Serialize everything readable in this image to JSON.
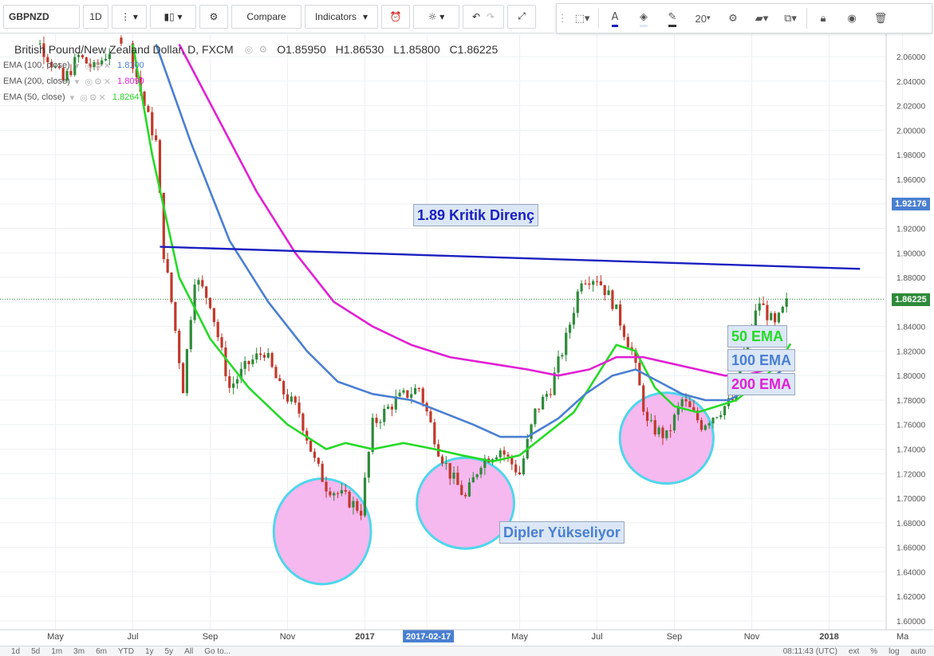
{
  "toolbar": {
    "symbol": "GBPNZD",
    "interval": "1D",
    "compare_label": "Compare",
    "indicators_label": "Indicators",
    "font_size": "20"
  },
  "legend": {
    "title": "British Pound/New Zealand Dollar, D, FXCM",
    "open": "O1.85950",
    "high": "H1.86530",
    "low": "L1.85800",
    "close": "C1.86225",
    "ema_rows": [
      {
        "label": "EMA (100, close)",
        "value": "1.8100",
        "color": "#4a7fd1"
      },
      {
        "label": "EMA (200, close)",
        "value": "1.8090",
        "color": "#e020d4"
      },
      {
        "label": "EMA (50, close)",
        "value": "1.8264",
        "color": "#26d926"
      }
    ]
  },
  "annotations": {
    "resistance": "1.89 Kritik Direnç",
    "ema50": "50 EMA",
    "ema100": "100 EMA",
    "ema200": "200 EMA",
    "lows": "Dipler Yükseliyor"
  },
  "price_tags": {
    "current": "1.86225",
    "upper": "1.92176"
  },
  "bottom": {
    "ranges": [
      "1d",
      "5d",
      "1m",
      "3m",
      "6m",
      "YTD",
      "1y",
      "5y",
      "All",
      "Go to..."
    ],
    "time": "08:11:43 (UTC)",
    "right": [
      "ext",
      "%",
      "log",
      "auto"
    ]
  },
  "colors": {
    "ema50": "#26d926",
    "ema100": "#4a7fd1",
    "ema200": "#e020d4",
    "resistance": "#1a1fbf",
    "candle_up": "#2e8b3a",
    "candle_down": "#c0392b",
    "circle_fill": "#f5b8ef",
    "circle_stroke": "#4fd6ea"
  },
  "chart_data": {
    "type": "candlestick",
    "title": "British Pound/New Zealand Dollar, D, FXCM",
    "x_ticks": [
      "May",
      "Jul",
      "Sep",
      "Nov",
      "2017",
      "2017-02-17",
      "May",
      "Jul",
      "Sep",
      "Nov",
      "2018",
      "Ma"
    ],
    "y_ticks": [
      "1.60000",
      "1.62000",
      "1.64000",
      "1.66000",
      "1.68000",
      "1.70000",
      "1.72000",
      "1.74000",
      "1.76000",
      "1.78000",
      "1.80000",
      "1.82000",
      "1.84000",
      "1.86000",
      "1.88000",
      "1.90000",
      "1.92000",
      "1.94000",
      "1.96000",
      "1.98000",
      "2.00000",
      "2.02000",
      "2.04000",
      "2.06000"
    ],
    "ylim": [
      1.595,
      2.075
    ],
    "x_month_range": [
      0,
      22.5
    ],
    "x_month_ticks": [
      1,
      3,
      5,
      7,
      9,
      10.6,
      13,
      15,
      17,
      19,
      21,
      22.9
    ],
    "resistance_line": {
      "x": [
        3.7,
        21.8
      ],
      "y": [
        1.905,
        1.887
      ]
    },
    "current_price": 1.86225,
    "price_path": [
      [
        0.0,
        2.09
      ],
      [
        0.6,
        2.07
      ],
      [
        1.2,
        2.04
      ],
      [
        1.6,
        2.06
      ],
      [
        2.0,
        2.05
      ],
      [
        2.8,
        2.08
      ],
      [
        3.3,
        2.02
      ],
      [
        3.6,
        1.99
      ],
      [
        3.8,
        1.9
      ],
      [
        4.0,
        1.86
      ],
      [
        4.3,
        1.79
      ],
      [
        4.6,
        1.88
      ],
      [
        5.0,
        1.86
      ],
      [
        5.5,
        1.79
      ],
      [
        6.0,
        1.81
      ],
      [
        6.4,
        1.82
      ],
      [
        6.8,
        1.79
      ],
      [
        7.3,
        1.77
      ],
      [
        7.7,
        1.73
      ],
      [
        8.0,
        1.71
      ],
      [
        8.5,
        1.7
      ],
      [
        8.9,
        1.69
      ],
      [
        9.2,
        1.76
      ],
      [
        9.8,
        1.78
      ],
      [
        10.4,
        1.79
      ],
      [
        10.9,
        1.74
      ],
      [
        11.2,
        1.72
      ],
      [
        11.6,
        1.7
      ],
      [
        12.0,
        1.73
      ],
      [
        12.5,
        1.74
      ],
      [
        13.0,
        1.72
      ],
      [
        13.4,
        1.77
      ],
      [
        13.8,
        1.79
      ],
      [
        14.2,
        1.83
      ],
      [
        14.6,
        1.88
      ],
      [
        15.0,
        1.88
      ],
      [
        15.4,
        1.86
      ],
      [
        15.9,
        1.82
      ],
      [
        16.3,
        1.76
      ],
      [
        16.8,
        1.75
      ],
      [
        17.2,
        1.78
      ],
      [
        17.7,
        1.76
      ],
      [
        18.1,
        1.77
      ],
      [
        18.5,
        1.78
      ],
      [
        18.8,
        1.82
      ],
      [
        19.2,
        1.86
      ],
      [
        19.6,
        1.84
      ],
      [
        20.0,
        1.865
      ]
    ],
    "series": [
      {
        "name": "EMA (50, close)",
        "value": 1.8264,
        "points": [
          [
            3.0,
            2.07
          ],
          [
            3.5,
            1.98
          ],
          [
            4.2,
            1.88
          ],
          [
            5.0,
            1.83
          ],
          [
            6.0,
            1.79
          ],
          [
            7.0,
            1.76
          ],
          [
            8.0,
            1.74
          ],
          [
            8.5,
            1.745
          ],
          [
            9.2,
            1.74
          ],
          [
            10.0,
            1.745
          ],
          [
            10.8,
            1.74
          ],
          [
            11.5,
            1.735
          ],
          [
            12.3,
            1.73
          ],
          [
            13.0,
            1.735
          ],
          [
            13.6,
            1.75
          ],
          [
            14.4,
            1.77
          ],
          [
            15.0,
            1.8
          ],
          [
            15.5,
            1.825
          ],
          [
            16.0,
            1.82
          ],
          [
            16.5,
            1.79
          ],
          [
            17.0,
            1.775
          ],
          [
            17.6,
            1.77
          ],
          [
            18.1,
            1.775
          ],
          [
            18.6,
            1.78
          ],
          [
            19.2,
            1.795
          ],
          [
            19.7,
            1.81
          ],
          [
            20.0,
            1.826
          ]
        ]
      },
      {
        "name": "EMA (100, close)",
        "value": 1.81,
        "points": [
          [
            3.6,
            2.07
          ],
          [
            4.5,
            1.99
          ],
          [
            5.5,
            1.91
          ],
          [
            6.5,
            1.86
          ],
          [
            7.5,
            1.82
          ],
          [
            8.3,
            1.795
          ],
          [
            9.2,
            1.785
          ],
          [
            10.2,
            1.78
          ],
          [
            11.0,
            1.77
          ],
          [
            11.8,
            1.76
          ],
          [
            12.5,
            1.75
          ],
          [
            13.2,
            1.75
          ],
          [
            14.0,
            1.765
          ],
          [
            14.7,
            1.785
          ],
          [
            15.4,
            1.8
          ],
          [
            16.0,
            1.805
          ],
          [
            16.6,
            1.795
          ],
          [
            17.2,
            1.785
          ],
          [
            17.8,
            1.78
          ],
          [
            18.4,
            1.78
          ],
          [
            19.0,
            1.79
          ],
          [
            19.6,
            1.8
          ],
          [
            20.0,
            1.81
          ]
        ]
      },
      {
        "name": "EMA (200, close)",
        "value": 1.809,
        "points": [
          [
            4.2,
            2.07
          ],
          [
            5.2,
            2.01
          ],
          [
            6.2,
            1.95
          ],
          [
            7.2,
            1.9
          ],
          [
            8.2,
            1.86
          ],
          [
            9.2,
            1.84
          ],
          [
            10.2,
            1.825
          ],
          [
            11.2,
            1.815
          ],
          [
            12.2,
            1.81
          ],
          [
            13.2,
            1.805
          ],
          [
            14.0,
            1.8
          ],
          [
            14.8,
            1.805
          ],
          [
            15.5,
            1.815
          ],
          [
            16.2,
            1.815
          ],
          [
            16.9,
            1.81
          ],
          [
            17.6,
            1.805
          ],
          [
            18.3,
            1.8
          ],
          [
            18.8,
            1.8
          ],
          [
            19.4,
            1.805
          ],
          [
            20.0,
            1.809
          ]
        ]
      }
    ],
    "low_zones": [
      {
        "x": 7.9,
        "y": 1.673,
        "rx": 1.35,
        "ry": 0.043
      },
      {
        "x": 11.6,
        "y": 1.696,
        "rx": 1.35,
        "ry": 0.037
      },
      {
        "x": 16.8,
        "y": 1.749,
        "rx": 1.3,
        "ry": 0.037
      }
    ]
  }
}
